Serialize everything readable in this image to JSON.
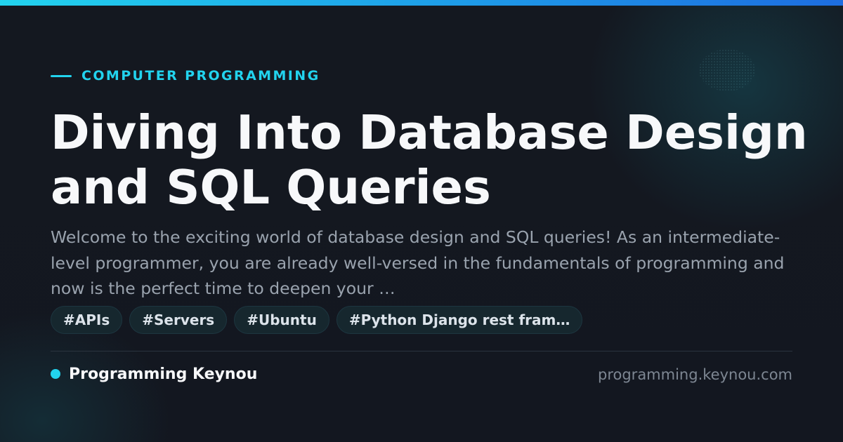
{
  "eyebrow": {
    "text": "COMPUTER PROGRAMMING"
  },
  "title": "Diving Into Database Design and SQL Queries",
  "description": "Welcome to the exciting world of database design and SQL queries! As an intermediate-level programmer, you are already well-versed in the fundamentals of programming and now is the perfect time to deepen your …",
  "tags": [
    "#APIs",
    "#Servers",
    "#Ubuntu",
    "#Python Django rest fram…"
  ],
  "footer": {
    "brand": "Programming Keynou",
    "domain": "programming.keynou.com"
  },
  "colors": {
    "accent": "#22d3ee",
    "background": "#141821",
    "title": "#f7f8fa",
    "body_text": "#9aa3ae"
  }
}
